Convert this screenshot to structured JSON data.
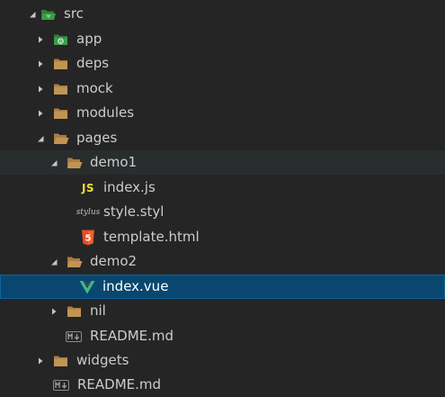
{
  "explorer": {
    "items": [
      {
        "label": "src",
        "kind": "folder-open",
        "icon": "src-folder-icon",
        "expanded": true
      },
      {
        "label": "app",
        "kind": "folder",
        "icon": "app-folder-icon",
        "expanded": false
      },
      {
        "label": "deps",
        "kind": "folder",
        "icon": "folder-icon",
        "expanded": false
      },
      {
        "label": "mock",
        "kind": "folder",
        "icon": "folder-icon",
        "expanded": false
      },
      {
        "label": "modules",
        "kind": "folder",
        "icon": "folder-icon",
        "expanded": false
      },
      {
        "label": "pages",
        "kind": "folder-open",
        "icon": "folder-open-icon",
        "expanded": true
      },
      {
        "label": "demo1",
        "kind": "folder-open",
        "icon": "folder-open-icon",
        "expanded": true
      },
      {
        "label": "index.js",
        "kind": "file",
        "icon": "javascript-file-icon",
        "icon_text": "JS"
      },
      {
        "label": "style.styl",
        "kind": "file",
        "icon": "stylus-file-icon",
        "icon_text": "stylus"
      },
      {
        "label": "template.html",
        "kind": "file",
        "icon": "html5-file-icon"
      },
      {
        "label": "demo2",
        "kind": "folder-open",
        "icon": "folder-open-icon",
        "expanded": true
      },
      {
        "label": "index.vue",
        "kind": "file",
        "icon": "vue-file-icon",
        "selected": true
      },
      {
        "label": "nil",
        "kind": "folder",
        "icon": "folder-icon",
        "expanded": false
      },
      {
        "label": "README.md",
        "kind": "file",
        "icon": "markdown-file-icon"
      },
      {
        "label": "widgets",
        "kind": "folder",
        "icon": "folder-icon",
        "expanded": false
      },
      {
        "label": "README.md",
        "kind": "file",
        "icon": "markdown-file-icon"
      }
    ]
  },
  "colors": {
    "background": "#252526",
    "hover_background": "#2a2d2e",
    "selected_background": "#094771",
    "folder": "#c09553",
    "src_folder": "#3d9b47",
    "js": "#f1dd35",
    "html5": "#e44d26",
    "vue": "#41b883",
    "markdown": "#a0a0a0"
  }
}
